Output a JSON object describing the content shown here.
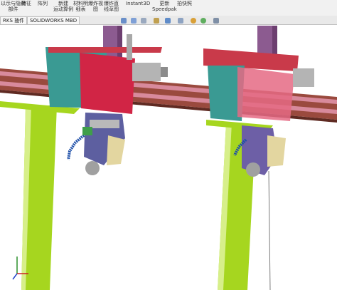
{
  "ribbon": {
    "items": [
      {
        "line1": "以示与隐藏",
        "line2": "部件"
      },
      {
        "line1": "特征",
        "line2": ""
      },
      {
        "line1": "阵列",
        "line2": ""
      },
      {
        "line1": "新建",
        "line2": "运动算例"
      },
      {
        "line1": "材料明",
        "line2": "细表"
      },
      {
        "line1": "爆炸视",
        "line2": "图"
      },
      {
        "line1": "爆炸直",
        "line2": "线草图"
      },
      {
        "line1": "Instant3D",
        "line2": ""
      },
      {
        "line1": "更新",
        "line2": "Speedpak"
      },
      {
        "line1": "拍快照",
        "line2": ""
      }
    ]
  },
  "tabs": {
    "items": [
      "RKS 插件",
      "SOLIDWORKS MBD"
    ]
  },
  "hud": {
    "icons": [
      "search-icon",
      "zoom-fit-icon",
      "section-view-icon",
      "view-orientation-icon",
      "display-style-icon",
      "hide-show-icon",
      "appearance-icon",
      "scene-icon",
      "view-settings-icon"
    ]
  },
  "colors": {
    "column_green": "#a6d61f",
    "carriage_crimson": "#d12545",
    "head_teal": "#3a9a93",
    "beam_brown": "#9a4a3e",
    "rail_pink": "#d88a9c",
    "mast_purple": "#8c5b90",
    "hose_blue": "#1e4fa8"
  }
}
